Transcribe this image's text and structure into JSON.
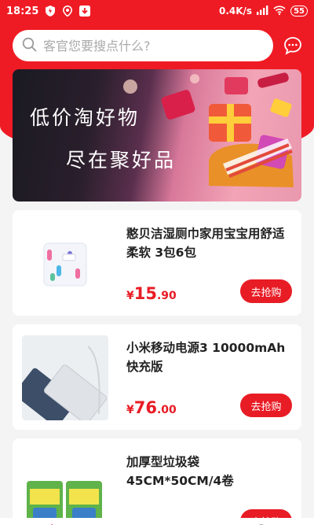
{
  "status_bar": {
    "time": "18:25",
    "network_speed": "0.4K/s",
    "battery": "55"
  },
  "search": {
    "placeholder": "客官您要搜点什么?"
  },
  "banner": {
    "line1": "低价淘好物",
    "line2": "尽在聚好品"
  },
  "products": [
    {
      "title": "憨贝洁湿厕巾家用宝宝用舒适柔软 3包6包",
      "currency": "¥",
      "price_int": "15",
      "price_dec": ".90",
      "button": "去抢购"
    },
    {
      "title": "小米移动电源3 10000mAh 快充版",
      "currency": "¥",
      "price_int": "76",
      "price_dec": ".00",
      "button": "去抢购"
    },
    {
      "title": "加厚型垃圾袋45CM*50CM/4卷",
      "currency": "¥",
      "price_int": "",
      "price_dec": "",
      "button": "去抢购"
    }
  ],
  "colors": {
    "brand": "#ef1b24",
    "price": "#e81c25",
    "background": "#f4f4f4"
  }
}
